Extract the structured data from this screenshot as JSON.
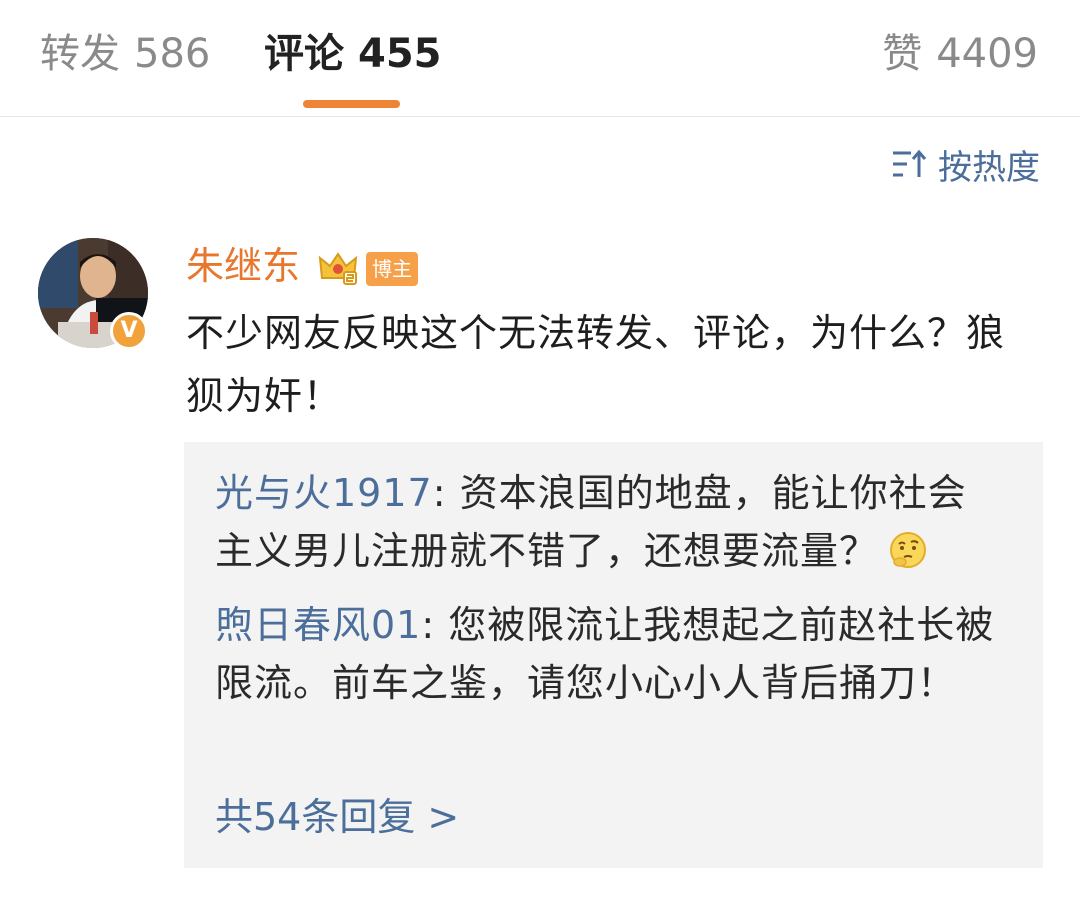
{
  "tabs": {
    "repost": {
      "label": "转发",
      "count": "586"
    },
    "comment": {
      "label": "评论",
      "count": "455"
    },
    "like": {
      "label": "赞",
      "count": "4409"
    }
  },
  "sort": {
    "label": "按热度"
  },
  "comment": {
    "user": "朱继东",
    "badge": "博主",
    "text": "不少网友反映这个无法转发、评论，为什么？狼狈为奸！"
  },
  "replies": [
    {
      "user": "光与火1917",
      "separator": ": ",
      "text": "资本浪国的地盘，能让你社会主义男儿注册就不错了，还想要流量？"
    },
    {
      "user": "煦日春风01",
      "separator": ": ",
      "text": "您被限流让我想起之前赵社长被限流。前车之鉴，请您小心小人背后捅刀！"
    }
  ],
  "more_replies": "共54条回复 >",
  "colors": {
    "accent_orange": "#f08435",
    "username_orange": "#e8762c",
    "link_blue": "#4b6e9a",
    "reply_bg": "#f3f3f3"
  },
  "icons": [
    "sort-icon",
    "verified-badge-icon",
    "crown-icon",
    "thinking-emoji-icon"
  ]
}
